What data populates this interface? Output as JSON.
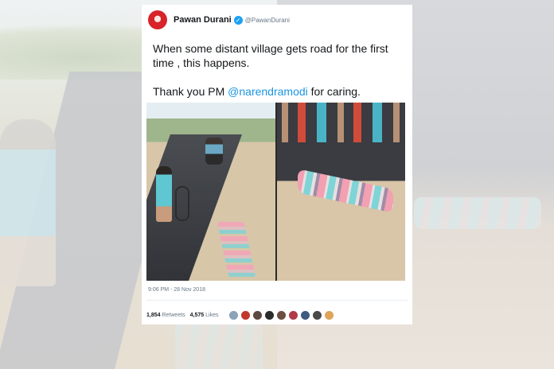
{
  "tweet": {
    "author_name": "Pawan Durani",
    "author_handle": "@PawanDurani",
    "text_line1": "When some distant village gets road for the first time , this happens.",
    "text_line2_prefix": "Thank you PM ",
    "mention": "@narendramodi",
    "text_line2_suffix": " for caring.",
    "timestamp": "9:06 PM - 28 Nov 2018",
    "retweets_count": "1,854",
    "retweets_label": "Retweets",
    "likes_count": "4,575",
    "likes_label": "Likes"
  },
  "colors": {
    "verified": "#1da1f2",
    "mention": "#1b95e0",
    "liker_avatars": [
      "#8aa3b8",
      "#c0392b",
      "#5a4a3f",
      "#2b2b2b",
      "#6d4c41",
      "#b23a48",
      "#3d5a80",
      "#4a4a4a",
      "#e0a458"
    ]
  },
  "icons": [
    "avatar",
    "verified-badge-icon"
  ]
}
